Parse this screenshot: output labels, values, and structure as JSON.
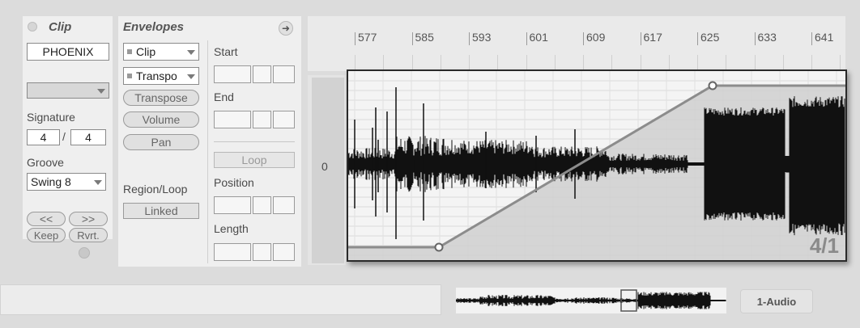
{
  "clip_panel": {
    "title": "Clip",
    "name_value": "PHOENIX",
    "signature_label": "Signature",
    "signature_numerator": "4",
    "signature_separator": "/",
    "signature_denominator": "4",
    "groove_label": "Groove",
    "groove_value": "Swing 8",
    "nudge_back_label": "<<",
    "nudge_forward_label": ">>",
    "keep_label": "Keep",
    "revert_label": "Rvrt."
  },
  "envelopes_panel": {
    "title": "Envelopes",
    "device_select": "Clip",
    "control_select": "Transpo",
    "buttons": [
      "Transpose",
      "Volume",
      "Pan"
    ],
    "start_label": "Start",
    "end_label": "End",
    "loop_label": "Loop",
    "position_label": "Position",
    "length_label": "Length",
    "region_loop_label": "Region/Loop",
    "linked_label": "Linked"
  },
  "ruler": {
    "bars": [
      "577",
      "585",
      "593",
      "601",
      "609",
      "617",
      "625",
      "633",
      "641"
    ]
  },
  "editor": {
    "zero_label": "0",
    "zoom_readout": "4/1"
  },
  "overview": {
    "track_label": "1-Audio"
  },
  "colors": {
    "background": "#dcdcdc",
    "panel": "#efefef",
    "envelope_fill": "#cfcfcf",
    "envelope_line": "#8c8c8c",
    "waveform": "#111111"
  }
}
